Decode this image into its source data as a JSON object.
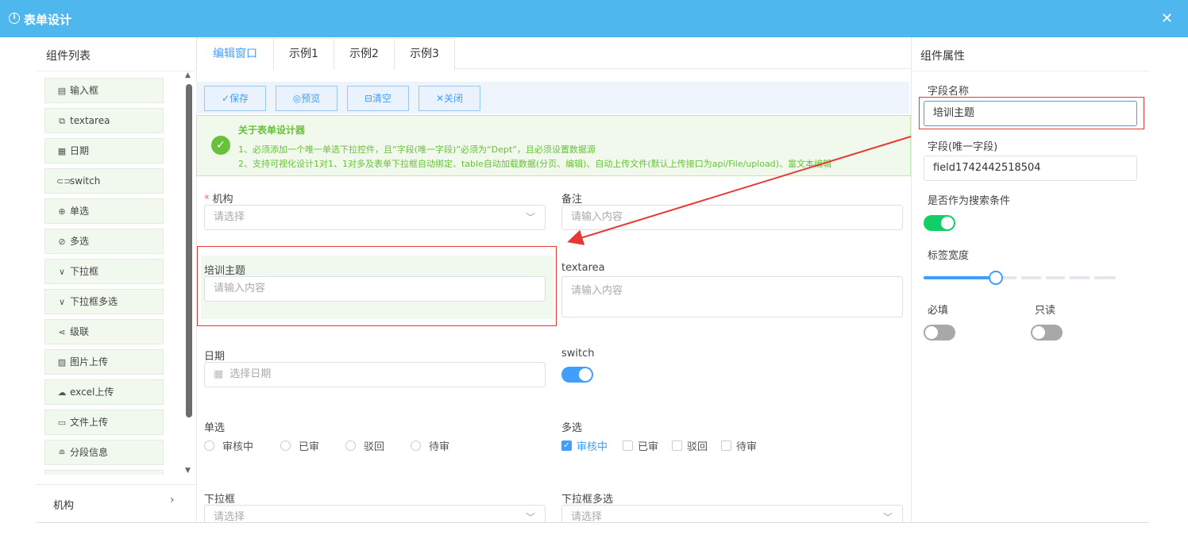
{
  "header": {
    "title": "表单设计",
    "info_icon": "i",
    "close": "✕"
  },
  "left": {
    "title": "组件列表",
    "items": [
      {
        "label": "输入框",
        "icon": "▤"
      },
      {
        "label": "textarea",
        "icon": "⧉"
      },
      {
        "label": "日期",
        "icon": "▦"
      },
      {
        "label": "switch",
        "icon": "⊂⊃"
      },
      {
        "label": "单选",
        "icon": "⊕"
      },
      {
        "label": "多选",
        "icon": "⊘"
      },
      {
        "label": "下拉框",
        "icon": "∨"
      },
      {
        "label": "下拉框多选",
        "icon": "∨"
      },
      {
        "label": "级联",
        "icon": "⋖"
      },
      {
        "label": "图片上传",
        "icon": "▨"
      },
      {
        "label": "excel上传",
        "icon": "☁"
      },
      {
        "label": "文件上传",
        "icon": "▭"
      },
      {
        "label": "分段信息",
        "icon": "≘"
      }
    ],
    "bottom_label": "机构",
    "bottom_arrow": "›"
  },
  "tabs": [
    "编辑窗口",
    "示例1",
    "示例2",
    "示例3"
  ],
  "toolbar": {
    "save": "✓保存",
    "preview": "◎预览",
    "clear": "⊟清空",
    "close": "✕关闭"
  },
  "notice": {
    "title": "关于表单设计器",
    "line1": "1、必须添加一个唯一单选下拉控件，且“字段(唯一字段)”必须为“Dept”，且必须设置数据源",
    "line2": "2、支持可视化设计1对1、1对多及表单下拉框自动绑定、table自动加载数据(分页、编辑)、自动上传文件(默认上传接口为api/File/upload)、富文本编辑"
  },
  "form": {
    "org_label": "机构",
    "org_required": "*",
    "org_placeholder": "请选择",
    "remark_label": "备注",
    "remark_placeholder": "请输入内容",
    "topic_label": "培训主题",
    "topic_placeholder": "请输入内容",
    "textarea_label": "textarea",
    "textarea_placeholder": "请输入内容",
    "date_label": "日期",
    "date_icon": "▦",
    "date_placeholder": "选择日期",
    "switch_label": "switch",
    "switch_on": true,
    "radio_label": "单选",
    "radio_options": [
      "审核中",
      "已审",
      "驳回",
      "待审"
    ],
    "checkbox_label": "多选",
    "checkbox_options": [
      "审核中",
      "已审",
      "驳回",
      "待审"
    ],
    "checkbox_checked_index": 0,
    "select_label": "下拉框",
    "select_placeholder": "请选择",
    "multiselect_label": "下拉框多选",
    "multiselect_placeholder": "请选择"
  },
  "props": {
    "title": "组件属性",
    "field_name_label": "字段名称",
    "field_name_value": "培训主题",
    "field_key_label": "字段(唯一字段)",
    "field_key_value": "field1742442518504",
    "search_label": "是否作为搜索条件",
    "search_on": true,
    "label_width_label": "标签宽度",
    "label_width_value": 0.375,
    "required_label": "必填",
    "required_on": false,
    "readonly_label": "只读",
    "readonly_on": false
  },
  "colors": {
    "accent": "#409eff",
    "header": "#4eb8ee",
    "success": "#67c23a",
    "switch_green": "#13ce66",
    "annotation": "#e53935"
  }
}
